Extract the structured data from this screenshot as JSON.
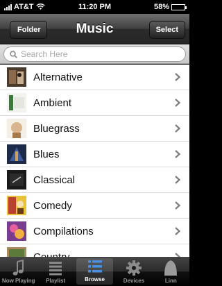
{
  "status_bar": {
    "carrier": "AT&T",
    "time": "11:20 PM",
    "battery": "58%",
    "battery_level": 0.58
  },
  "nav": {
    "title": "Music",
    "back_label": "Folder",
    "select_label": "Select"
  },
  "search": {
    "placeholder": "Search Here"
  },
  "genres": [
    {
      "label": "Alternative",
      "art_icon": "album-art-alternative"
    },
    {
      "label": "Ambient",
      "art_icon": "album-art-ambient"
    },
    {
      "label": "Bluegrass",
      "art_icon": "album-art-bluegrass"
    },
    {
      "label": "Blues",
      "art_icon": "album-art-blues"
    },
    {
      "label": "Classical",
      "art_icon": "album-art-classical"
    },
    {
      "label": "Comedy",
      "art_icon": "album-art-comedy"
    },
    {
      "label": "Compilations",
      "art_icon": "album-art-compilations"
    },
    {
      "label": "Country",
      "art_icon": "album-art-country"
    }
  ],
  "tabs": [
    {
      "label": "Now Playing",
      "icon": "music-note-icon",
      "active": false
    },
    {
      "label": "Playlist",
      "icon": "list-icon",
      "active": false
    },
    {
      "label": "Browse",
      "icon": "browse-list-icon",
      "active": true
    },
    {
      "label": "Devices",
      "icon": "gear-icon",
      "active": false
    },
    {
      "label": "Linn",
      "icon": "linn-icon",
      "active": false
    }
  ],
  "colors": {
    "selected_tab_label": "#ffffff",
    "tab_label": "#999999",
    "accent_blue": "#4a90e2"
  }
}
